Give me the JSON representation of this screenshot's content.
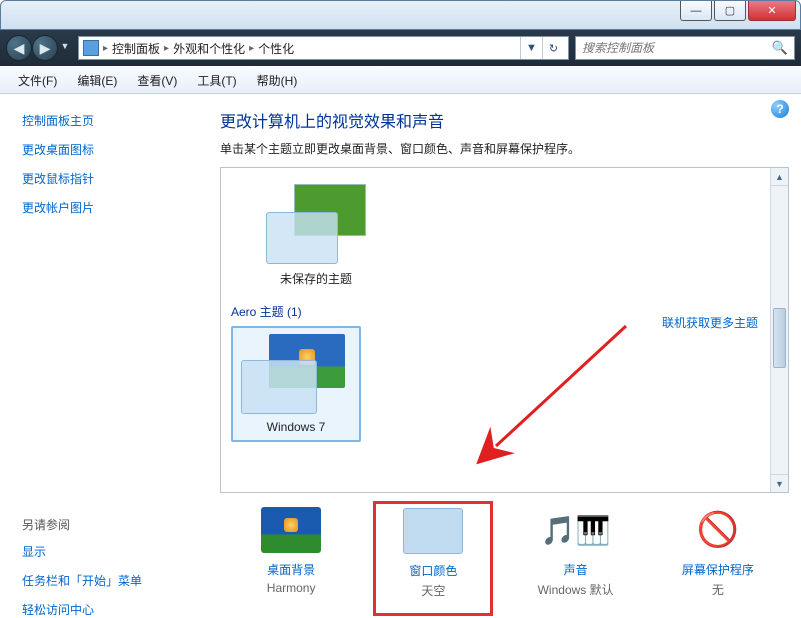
{
  "window": {
    "controls": {
      "min": "—",
      "max": "▢",
      "close": "✕"
    }
  },
  "nav": {
    "back": "◀",
    "forward": "▶",
    "dropdown": "▼",
    "breadcrumb": [
      "控制面板",
      "外观和个性化",
      "个性化"
    ],
    "addr_dropdown": "▼",
    "refresh": "↻"
  },
  "search": {
    "placeholder": "搜索控制面板",
    "icon": "🔍"
  },
  "menubar": [
    "文件(F)",
    "编辑(E)",
    "查看(V)",
    "工具(T)",
    "帮助(H)"
  ],
  "sidebar": {
    "items": [
      "控制面板主页",
      "更改桌面图标",
      "更改鼠标指针",
      "更改帐户图片"
    ],
    "also_label": "另请参阅",
    "also_items": [
      "显示",
      "任务栏和「开始」菜单",
      "轻松访问中心"
    ]
  },
  "content": {
    "title": "更改计算机上的视觉效果和声音",
    "desc": "单击某个主题立即更改桌面背景、窗口颜色、声音和屏幕保护程序。",
    "unsaved_theme_label": "未保存的主题",
    "online_link": "联机获取更多主题",
    "aero_header": "Aero 主题 (1)",
    "aero_theme_name": "Windows 7",
    "help": "?"
  },
  "settings": [
    {
      "label": "桌面背景",
      "value": "Harmony"
    },
    {
      "label": "窗口颜色",
      "value": "天空"
    },
    {
      "label": "声音",
      "value": "Windows 默认"
    },
    {
      "label": "屏幕保护程序",
      "value": "无"
    }
  ],
  "icons": {
    "sound": "🎵",
    "piano": "🎹",
    "saver_block": "🚫"
  }
}
